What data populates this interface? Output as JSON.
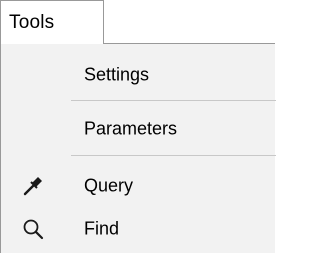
{
  "menubar": {
    "tools_label": "Tools"
  },
  "menu": {
    "items": [
      {
        "label": "Settings",
        "icon": ""
      },
      {
        "label": "Parameters",
        "icon": ""
      },
      {
        "label": "Query",
        "icon": "eyedropper-icon"
      },
      {
        "label": "Find",
        "icon": "magnifier-icon"
      }
    ]
  }
}
